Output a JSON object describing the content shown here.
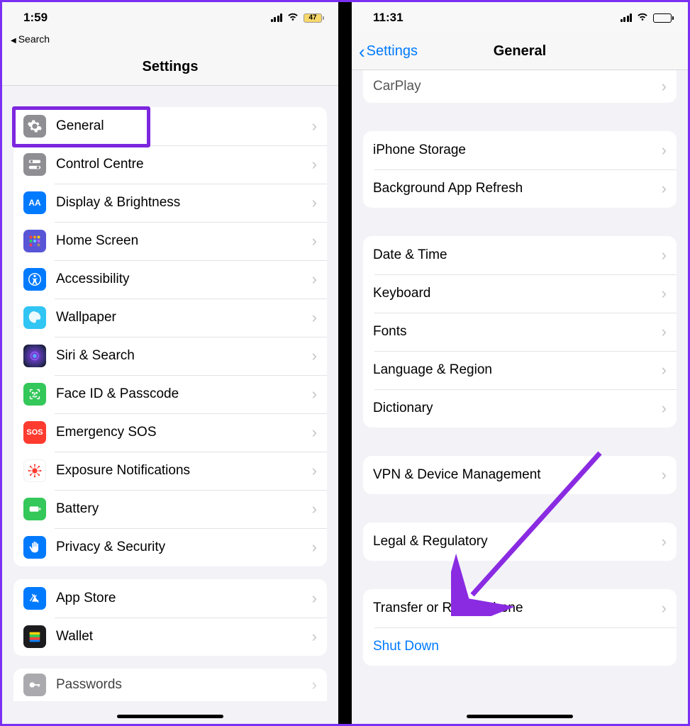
{
  "left": {
    "status": {
      "time": "1:59",
      "battery_text": "47"
    },
    "back_search": "Search",
    "title": "Settings",
    "group1": [
      {
        "label": "General"
      },
      {
        "label": "Control Centre"
      },
      {
        "label": "Display & Brightness"
      },
      {
        "label": "Home Screen"
      },
      {
        "label": "Accessibility"
      },
      {
        "label": "Wallpaper"
      },
      {
        "label": "Siri & Search"
      },
      {
        "label": "Face ID & Passcode"
      },
      {
        "label": "Emergency SOS"
      },
      {
        "label": "Exposure Notifications"
      },
      {
        "label": "Battery"
      },
      {
        "label": "Privacy & Security"
      }
    ],
    "group2": [
      {
        "label": "App Store"
      },
      {
        "label": "Wallet"
      }
    ],
    "group3_partial": {
      "label": "Passwords"
    }
  },
  "right": {
    "status": {
      "time": "11:31"
    },
    "back_label": "Settings",
    "title": "General",
    "partial_top": "CarPlay",
    "group1": [
      {
        "label": "iPhone Storage"
      },
      {
        "label": "Background App Refresh"
      }
    ],
    "group2": [
      {
        "label": "Date & Time"
      },
      {
        "label": "Keyboard"
      },
      {
        "label": "Fonts"
      },
      {
        "label": "Language & Region"
      },
      {
        "label": "Dictionary"
      }
    ],
    "group3": [
      {
        "label": "VPN & Device Management"
      }
    ],
    "group4": [
      {
        "label": "Legal & Regulatory"
      }
    ],
    "group5": [
      {
        "label": "Transfer or Reset iPhone"
      },
      {
        "label": "Shut Down",
        "blue": true
      }
    ]
  }
}
